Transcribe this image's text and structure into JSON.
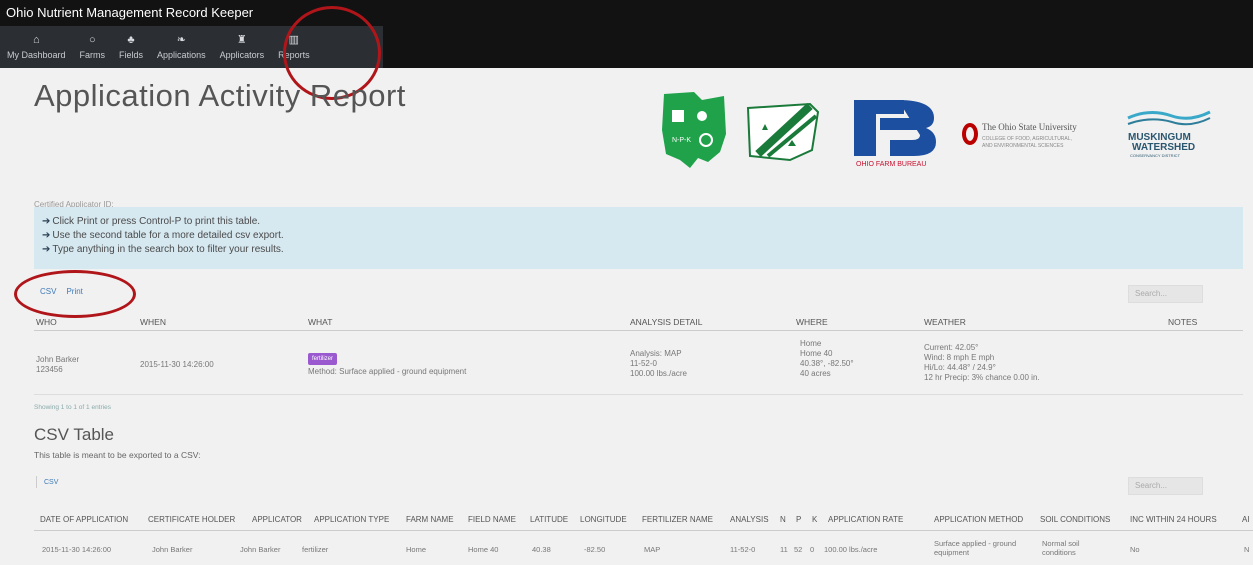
{
  "app_title": "Ohio Nutrient Management Record Keeper",
  "nav": [
    {
      "icon": "home-icon",
      "glyph": "⌂",
      "label": "My Dashboard"
    },
    {
      "icon": "circle-icon",
      "glyph": "○",
      "label": "Farms"
    },
    {
      "icon": "plant-icon",
      "glyph": "♣",
      "label": "Fields"
    },
    {
      "icon": "leaf-icon",
      "glyph": "❧",
      "label": "Applications"
    },
    {
      "icon": "users-icon",
      "glyph": "♜",
      "label": "Applicators"
    },
    {
      "icon": "bar-chart-icon",
      "glyph": "▥",
      "label": "Reports"
    }
  ],
  "page_title": "Application Activity Report",
  "logos": {
    "ohio_state_name": "The Ohio State University",
    "ohio_state_sub1": "COLLEGE OF FOOD, AGRICULTURAL,",
    "ohio_state_sub2": "AND ENVIRONMENTAL SCIENCES",
    "farm_bureau": "OHIO FARM BUREAU",
    "muskingum1": "MUSKINGUM",
    "muskingum2": "WATERSHED",
    "muskingum3": "CONSERVANCY DISTRICT",
    "npk": "N-P-K"
  },
  "certified_label": "Certified Applicator ID:",
  "info": [
    "Click Print or press Control-P to print this table.",
    "Use the second table for a more detailed csv export.",
    "Type anything in the search box to filter your results."
  ],
  "tools": {
    "csv": "CSV",
    "print": "Print"
  },
  "search_placeholder": "Search...",
  "report_table": {
    "headers": [
      "WHO",
      "WHEN",
      "WHAT",
      "ANALYSIS DETAIL",
      "WHERE",
      "WEATHER",
      "NOTES"
    ],
    "row": {
      "who": [
        "John Barker",
        "123456"
      ],
      "when": "2015-11-30 14:26:00",
      "badge": "fertilizer",
      "method": "Method: Surface applied - ground equipment",
      "analysis": [
        "Analysis: MAP",
        "11-52-0",
        "100.00 lbs./acre"
      ],
      "where": [
        "Home",
        "Home 40",
        "40.38°, -82.50°",
        "40 acres"
      ],
      "weather": [
        "Current: 42.05°",
        "Wind: 8 mph E mph",
        "Hi/Lo: 44.48° / 24.9°",
        "12 hr Precip: 3% chance 0.00 in."
      ]
    }
  },
  "showing": "Showing 1 to 1 of 1 entries",
  "csv_section": {
    "title": "CSV Table",
    "subtitle": "This table is meant to be exported to a CSV:",
    "csv_link": "CSV",
    "headers": [
      "DATE OF APPLICATION",
      "CERTIFICATE HOLDER",
      "APPLICATOR",
      "APPLICATION TYPE",
      "FARM NAME",
      "FIELD NAME",
      "LATITUDE",
      "LONGITUDE",
      "FERTILIZER NAME",
      "ANALYSIS",
      "N",
      "P",
      "K",
      "APPLICATION RATE",
      "APPLICATION METHOD",
      "SOIL CONDITIONS",
      "INC WITHIN 24 HOURS",
      "AI"
    ],
    "row": [
      "2015-11-30 14:26:00",
      "John Barker",
      "John Barker",
      "fertilizer",
      "Home",
      "Home 40",
      "40.38",
      "-82.50",
      "MAP",
      "11-52-0",
      "11",
      "52",
      "0",
      "100.00 lbs./acre",
      "Surface applied - ground equipment",
      "Normal soil conditions",
      "No",
      "N"
    ]
  },
  "colors": {
    "accent_ring": "#b0151a",
    "info_bg": "#d6e8f0",
    "badge": "#9b59d0",
    "link": "#3d7ab8"
  }
}
